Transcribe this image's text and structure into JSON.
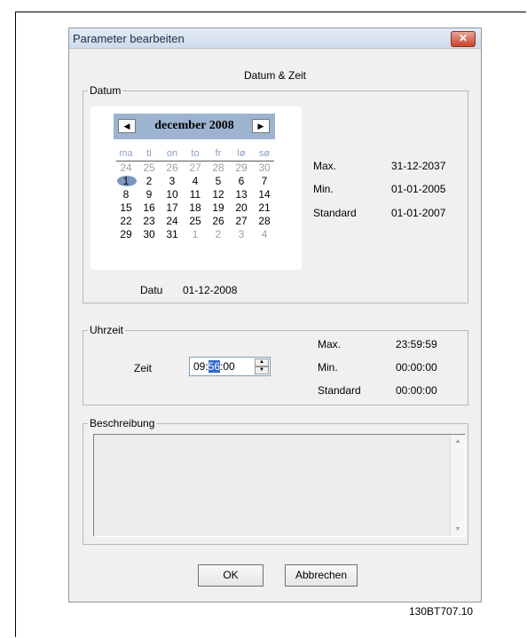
{
  "window": {
    "title": "Parameter bearbeiten",
    "close_glyph": "✕"
  },
  "caption": "Datum & Zeit",
  "datum": {
    "legend": "Datum",
    "calendar": {
      "prev_glyph": "◀",
      "next_glyph": "▶",
      "month_label": "december 2008",
      "weekdays": [
        "ma",
        "ti",
        "on",
        "to",
        "fr",
        "lø",
        "sø"
      ],
      "rows": [
        [
          "24",
          "25",
          "26",
          "27",
          "28",
          "29",
          "30"
        ],
        [
          "1",
          "2",
          "3",
          "4",
          "5",
          "6",
          "7"
        ],
        [
          "8",
          "9",
          "10",
          "11",
          "12",
          "13",
          "14"
        ],
        [
          "15",
          "16",
          "17",
          "18",
          "19",
          "20",
          "21"
        ],
        [
          "22",
          "23",
          "24",
          "25",
          "26",
          "27",
          "28"
        ],
        [
          "29",
          "30",
          "31",
          "1",
          "2",
          "3",
          "4"
        ]
      ],
      "selected_day": "1"
    },
    "date_label": "Datu",
    "date_value": "01-12-2008",
    "max_label": "Max.",
    "max_value": "31-12-2037",
    "min_label": "Min.",
    "min_value": "01-01-2005",
    "standard_label": "Standard",
    "standard_value": "01-01-2007"
  },
  "uhrzeit": {
    "legend": "Uhrzeit",
    "time_label": "Zeit",
    "time_hours": "09:",
    "time_minutes": "56",
    "time_seconds": ":00",
    "max_label": "Max.",
    "max_value": "23:59:59",
    "min_label": "Min.",
    "min_value": "00:00:00",
    "standard_label": "Standard",
    "standard_value": "00:00:00"
  },
  "beschreibung": {
    "legend": "Beschreibung",
    "text": ""
  },
  "buttons": {
    "ok": "OK",
    "cancel": "Abbrechen"
  },
  "figure_code": "130BT707.10",
  "colors": {
    "calendar_header": "#9db4d0",
    "selection": "#3369c8",
    "close_button": "#c8442c"
  }
}
